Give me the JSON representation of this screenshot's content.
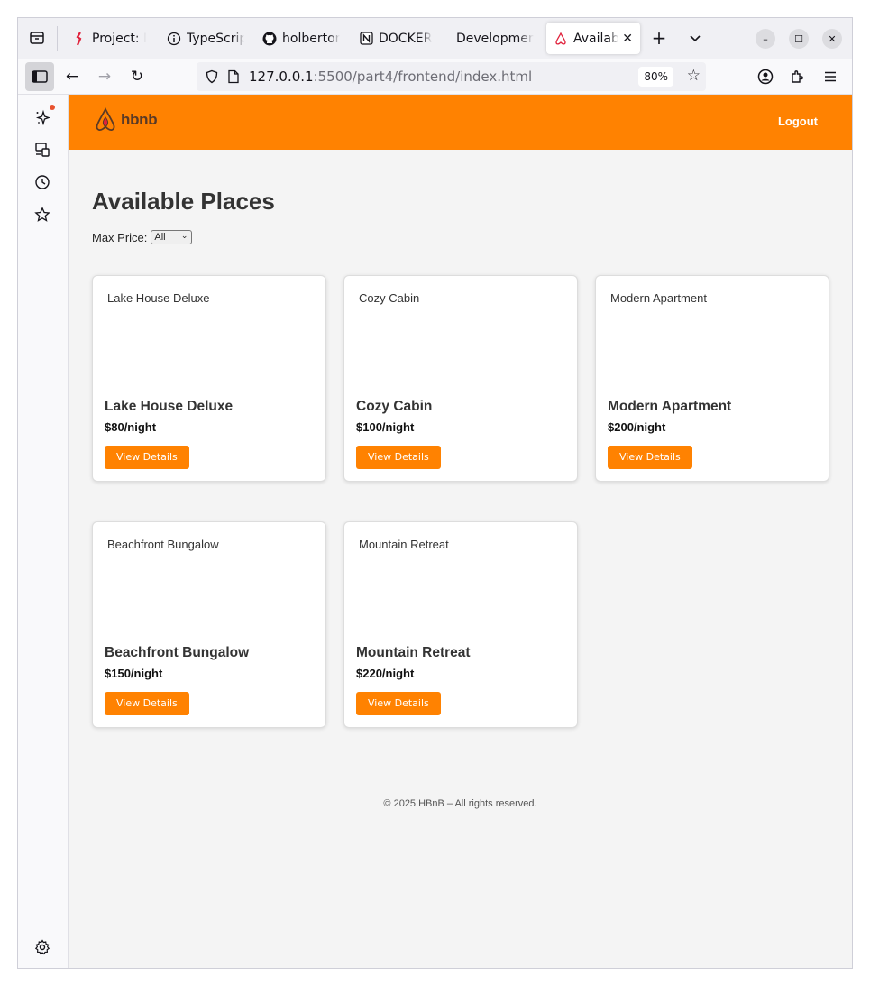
{
  "browser": {
    "tabs": [
      {
        "title": "Project: N",
        "icon": "holberton-icon"
      },
      {
        "title": "TypeScrip",
        "icon": "info-icon"
      },
      {
        "title": "holberton",
        "icon": "github-icon"
      },
      {
        "title": "DOCKER",
        "icon": "notion-icon"
      },
      {
        "title": "Developmen",
        "icon": "none"
      },
      {
        "title": "Availabl",
        "icon": "hbnb-favicon"
      }
    ],
    "url_host": "127.0.0.1",
    "url_rest": ":5500/part4/frontend/index.html",
    "zoom": "80%"
  },
  "site": {
    "logo_text": "hbnb",
    "logout_label": "Logout",
    "page_title": "Available Places",
    "filter_label": "Max Price:",
    "filter_value": "All",
    "footer": "© 2025 HBnB – All rights reserved."
  },
  "places": [
    {
      "image_alt": "Lake House Deluxe",
      "name": "Lake House Deluxe",
      "price": "$80/night",
      "button": "View Details"
    },
    {
      "image_alt": "Cozy Cabin",
      "name": "Cozy Cabin",
      "price": "$100/night",
      "button": "View Details"
    },
    {
      "image_alt": "Modern Apartment",
      "name": "Modern Apartment",
      "price": "$200/night",
      "button": "View Details"
    },
    {
      "image_alt": "Beachfront Bungalow",
      "name": "Beachfront Bungalow",
      "price": "$150/night",
      "button": "View Details"
    },
    {
      "image_alt": "Mountain Retreat",
      "name": "Mountain Retreat",
      "price": "$220/night",
      "button": "View Details"
    }
  ],
  "colors": {
    "brand": "#ff8201",
    "page_bg": "#f4f4f4"
  }
}
